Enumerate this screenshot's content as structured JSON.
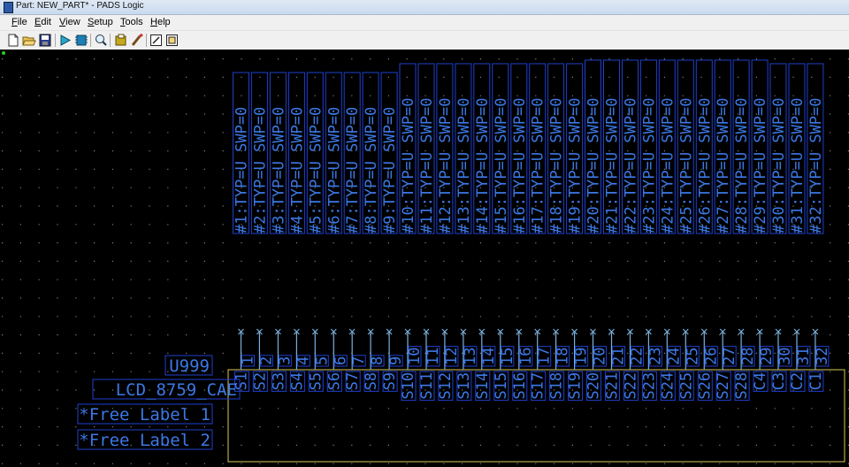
{
  "window": {
    "title": "Part: NEW_PART* - PADS Logic"
  },
  "menu": [
    {
      "label": "File",
      "accel": "F"
    },
    {
      "label": "Edit",
      "accel": "E"
    },
    {
      "label": "View",
      "accel": "V"
    },
    {
      "label": "Setup",
      "accel": "S"
    },
    {
      "label": "Tools",
      "accel": "T"
    },
    {
      "label": "Help",
      "accel": "H"
    }
  ],
  "toolbar": {
    "buttons": [
      {
        "name": "new-file-icon"
      },
      {
        "name": "open-folder-icon"
      },
      {
        "name": "save-icon"
      },
      {
        "name": "gate-icon"
      },
      {
        "name": "pin-icon"
      },
      {
        "name": "zoom-icon"
      },
      {
        "name": "attribute-icon"
      },
      {
        "name": "properties-icon"
      },
      {
        "name": "edit-graphics-icon"
      },
      {
        "name": "part-editor-icon"
      }
    ]
  },
  "colors": {
    "background": "#000000",
    "grid": "#7d7d7d",
    "text": "#3c78e6",
    "outline": "#1f3fcc",
    "pin": "#78b0dc",
    "body": "#b4a846"
  },
  "pin_attributes": [
    "#1:TYP=U SWP=0",
    "#2:TYP=U SWP=0",
    "#3:TYP=U SWP=0",
    "#4:TYP=U SWP=0",
    "#5:TYP=U SWP=0",
    "#6:TYP=U SWP=0",
    "#7:TYP=U SWP=0",
    "#8:TYP=U SWP=0",
    "#9:TYP=U SWP=0",
    "#10:TYP=U SWP=0",
    "#11:TYP=U SWP=0",
    "#12:TYP=U SWP=0",
    "#13:TYP=U SWP=0",
    "#14:TYP=U SWP=0",
    "#15:TYP=U SWP=0",
    "#16:TYP=U SWP=0",
    "#17:TYP=U SWP=0",
    "#18:TYP=U SWP=0",
    "#19:TYP=U SWP=0",
    "#20:TYP=U SWP=0",
    "#21:TYP=U SWP=0",
    "#22:TYP=U SWP=0",
    "#23:TYP=U SWP=0",
    "#24:TYP=U SWP=0",
    "#25:TYP=U SWP=0",
    "#26:TYP=U SWP=0",
    "#27:TYP=U SWP=0",
    "#28:TYP=U SWP=0",
    "#29:TYP=U SWP=0",
    "#30:TYP=U SWP=0",
    "#31:TYP=U SWP=0",
    "#32:TYP=U SWP=0"
  ],
  "pin_numbers": [
    "1",
    "2",
    "3",
    "4",
    "5",
    "6",
    "7",
    "8",
    "9",
    "10",
    "11",
    "12",
    "13",
    "14",
    "15",
    "16",
    "17",
    "18",
    "19",
    "20",
    "21",
    "22",
    "23",
    "24",
    "25",
    "26",
    "27",
    "28",
    "29",
    "30",
    "31",
    "32"
  ],
  "pin_names": [
    "S1",
    "S2",
    "S3",
    "S4",
    "S5",
    "S6",
    "S7",
    "S8",
    "S9",
    "S10",
    "S11",
    "S12",
    "S13",
    "S14",
    "S15",
    "S16",
    "S17",
    "S18",
    "S19",
    "S20",
    "S21",
    "S22",
    "S23",
    "S24",
    "S25",
    "S26",
    "S27",
    "S28",
    "C4",
    "C3",
    "C2",
    "C1"
  ],
  "part": {
    "ref_des": "U999",
    "part_type": "LCD_8759_CAE",
    "free_label_1": "*Free Label 1",
    "free_label_2": "*Free Label 2"
  }
}
